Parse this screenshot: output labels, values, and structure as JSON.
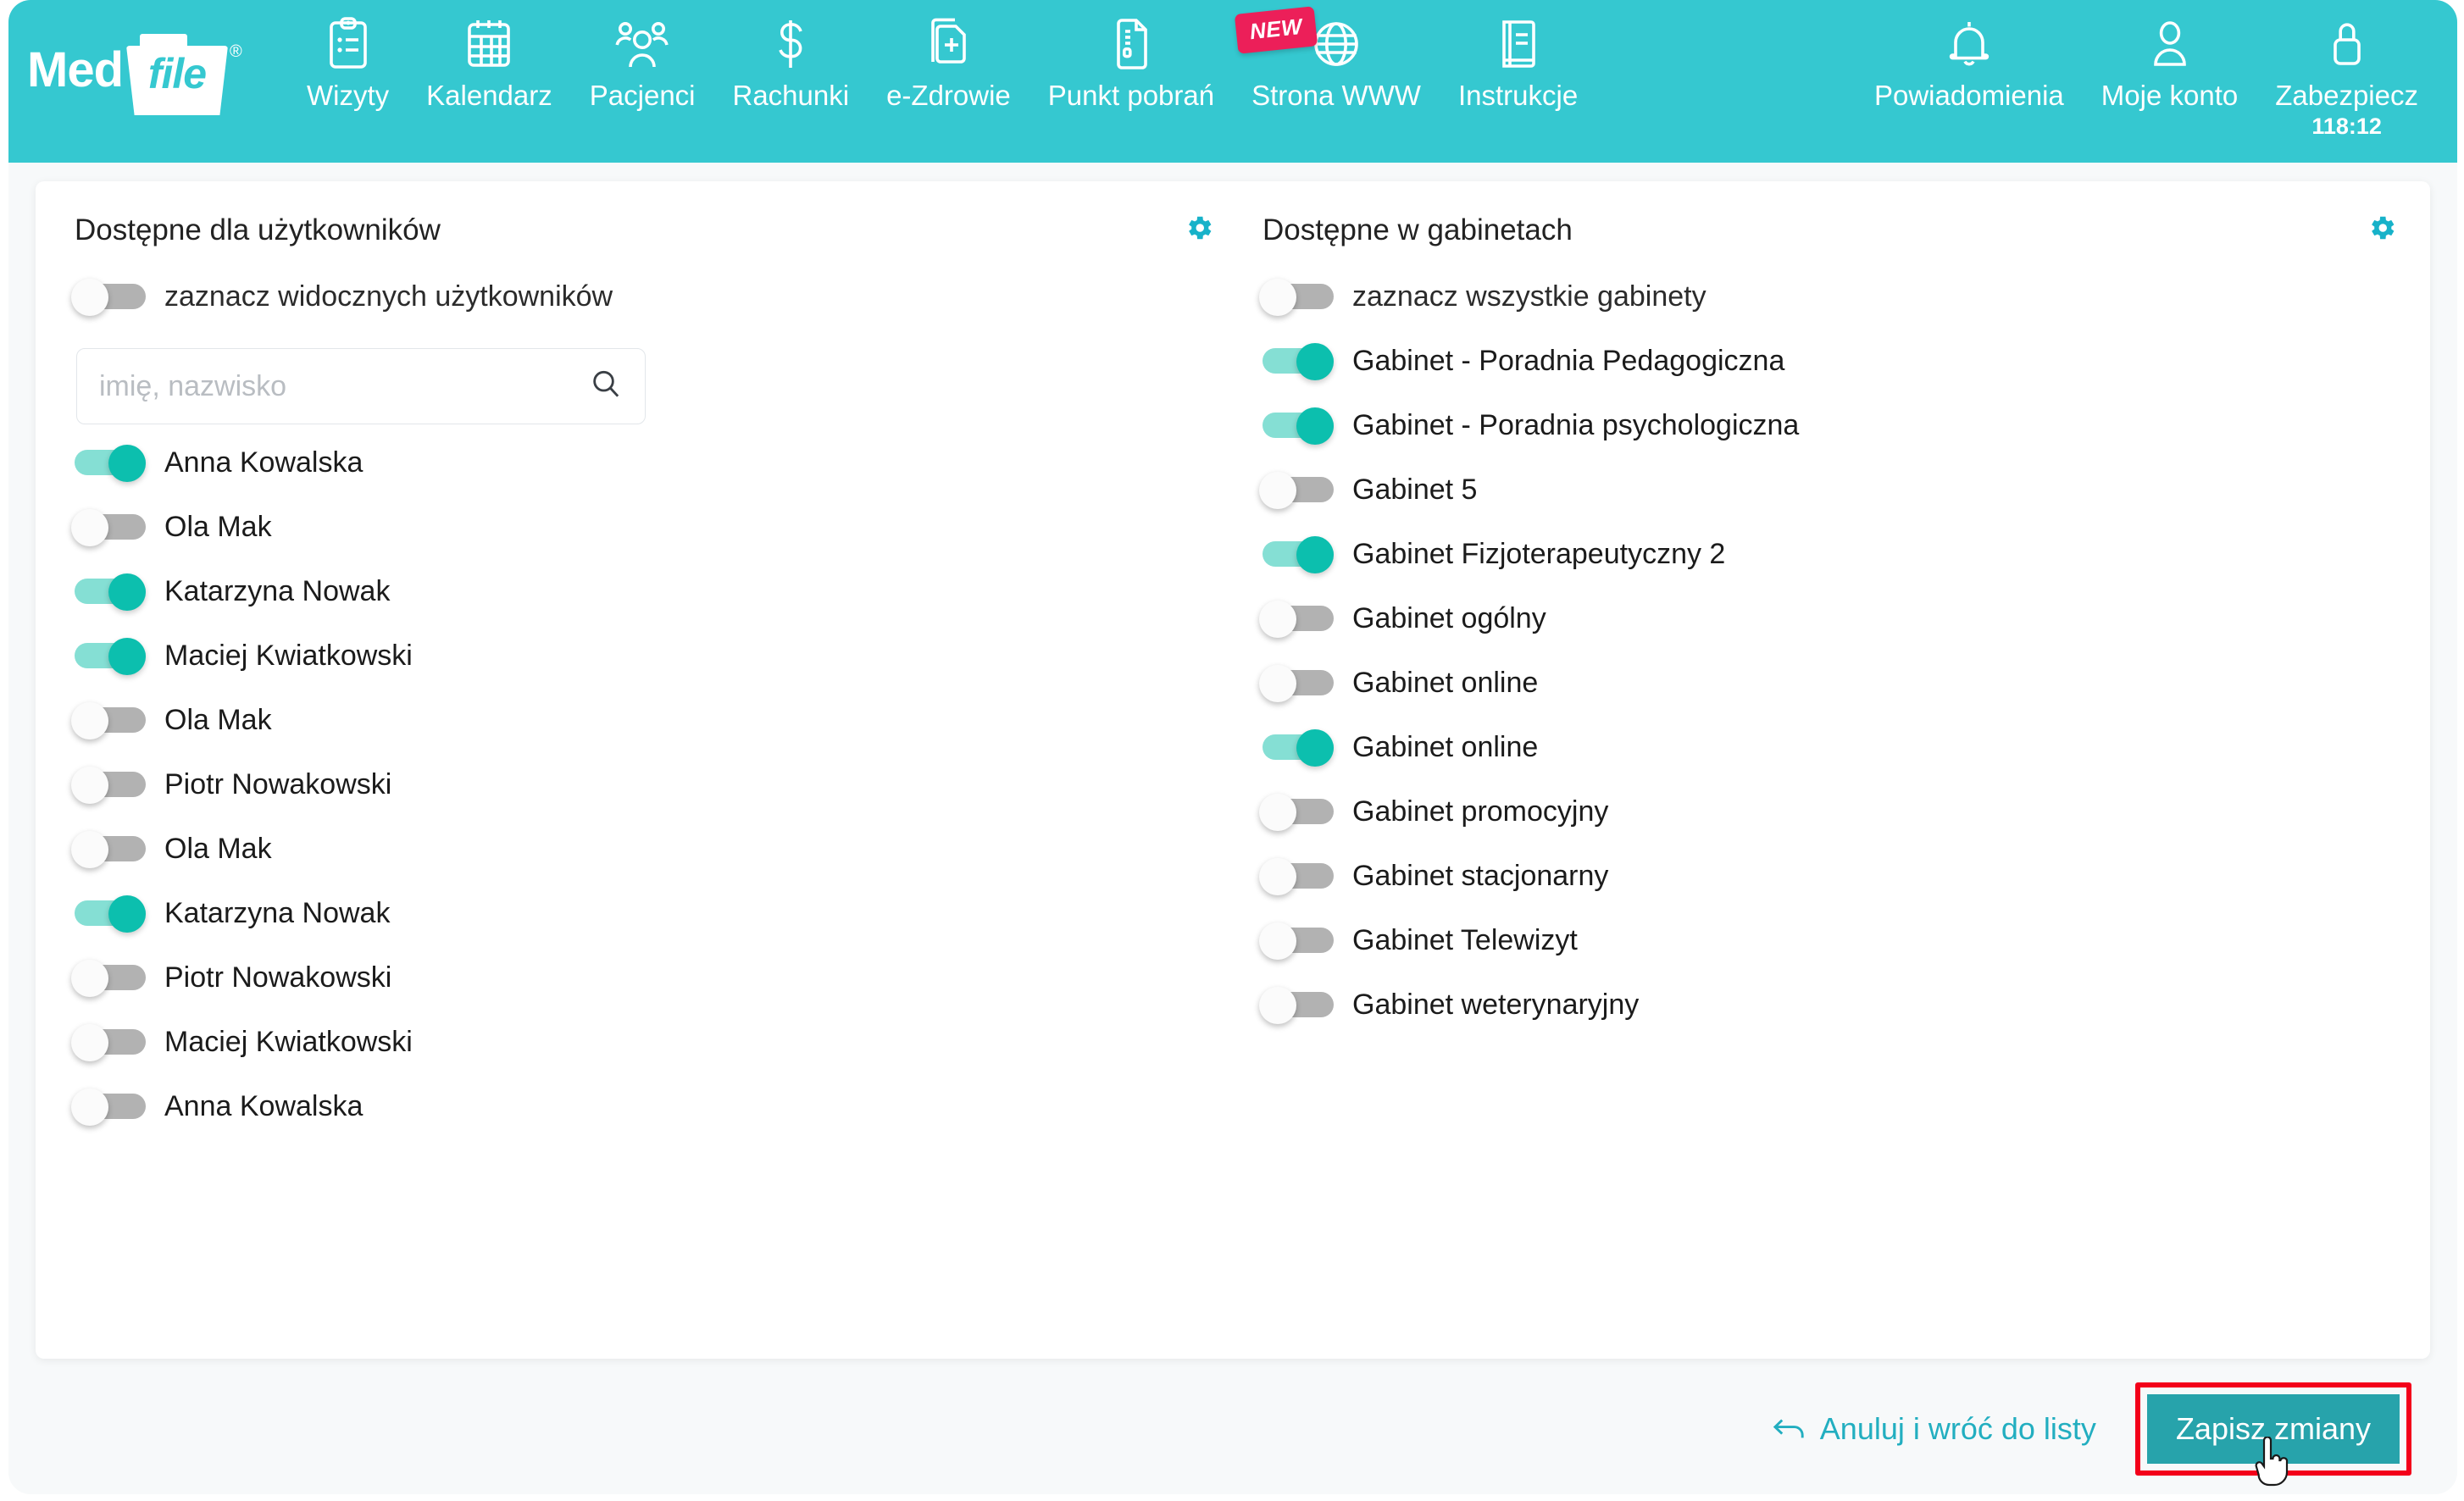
{
  "brand": {
    "name_part1": "Med",
    "name_part2": "file",
    "registered": "®",
    "header_color": "#35c8d0",
    "accent_color": "#0cbfae",
    "badge_color": "#ec1f59",
    "save_button_color": "#27a3ab",
    "highlight_color": "#f3001a"
  },
  "nav": {
    "items": [
      {
        "label": "Wizyty",
        "icon": "clipboard-icon"
      },
      {
        "label": "Kalendarz",
        "icon": "calendar-icon"
      },
      {
        "label": "Pacjenci",
        "icon": "people-icon"
      },
      {
        "label": "Rachunki",
        "icon": "dollar-icon"
      },
      {
        "label": "e-Zdrowie",
        "icon": "medical-document-icon"
      },
      {
        "label": "Punkt pobrań",
        "icon": "document-icon"
      },
      {
        "label": "Strona WWW",
        "icon": "globe-icon",
        "badge": "NEW"
      },
      {
        "label": "Instrukcje",
        "icon": "book-icon"
      }
    ],
    "right_items": [
      {
        "label": "Powiadomienia",
        "icon": "bell-icon"
      },
      {
        "label": "Moje konto",
        "icon": "user-icon"
      },
      {
        "label": "Zabezpiecz",
        "icon": "lock-icon",
        "sub": "118:12"
      }
    ]
  },
  "users_panel": {
    "title": "Dostępne dla użytkowników",
    "gear_icon": "gear-icon",
    "select_all": {
      "label": "zaznacz widocznych użytkowników",
      "on": false
    },
    "search": {
      "placeholder": "imię, nazwisko",
      "value": "",
      "icon": "search-icon"
    },
    "items": [
      {
        "label": "Anna Kowalska",
        "on": true
      },
      {
        "label": "Ola Mak",
        "on": false
      },
      {
        "label": "Katarzyna Nowak",
        "on": true
      },
      {
        "label": "Maciej Kwiatkowski",
        "on": true
      },
      {
        "label": "Ola Mak",
        "on": false
      },
      {
        "label": "Piotr Nowakowski",
        "on": false
      },
      {
        "label": "Ola Mak",
        "on": false
      },
      {
        "label": "Katarzyna Nowak",
        "on": true
      },
      {
        "label": "Piotr Nowakowski",
        "on": false
      },
      {
        "label": "Maciej Kwiatkowski",
        "on": false
      },
      {
        "label": "Anna Kowalska",
        "on": false
      }
    ]
  },
  "offices_panel": {
    "title": "Dostępne w gabinetach",
    "gear_icon": "gear-icon",
    "select_all": {
      "label": "zaznacz wszystkie gabinety",
      "on": false
    },
    "items": [
      {
        "label": "Gabinet - Poradnia Pedagogiczna",
        "on": true
      },
      {
        "label": "Gabinet - Poradnia psychologiczna",
        "on": true
      },
      {
        "label": "Gabinet 5",
        "on": false
      },
      {
        "label": "Gabinet Fizjoterapeutyczny 2",
        "on": true
      },
      {
        "label": "Gabinet ogólny",
        "on": false
      },
      {
        "label": "Gabinet online",
        "on": false
      },
      {
        "label": "Gabinet online",
        "on": true
      },
      {
        "label": "Gabinet promocyjny",
        "on": false
      },
      {
        "label": "Gabinet stacjonarny",
        "on": false
      },
      {
        "label": "Gabinet Telewizyt",
        "on": false
      },
      {
        "label": "Gabinet weterynaryjny",
        "on": false
      }
    ]
  },
  "footer": {
    "cancel_label": "Anuluj i wróć do listy",
    "cancel_icon": "back-arrow-icon",
    "save_label": "Zapisz zmiany",
    "cursor_icon": "pointer-cursor-icon"
  }
}
